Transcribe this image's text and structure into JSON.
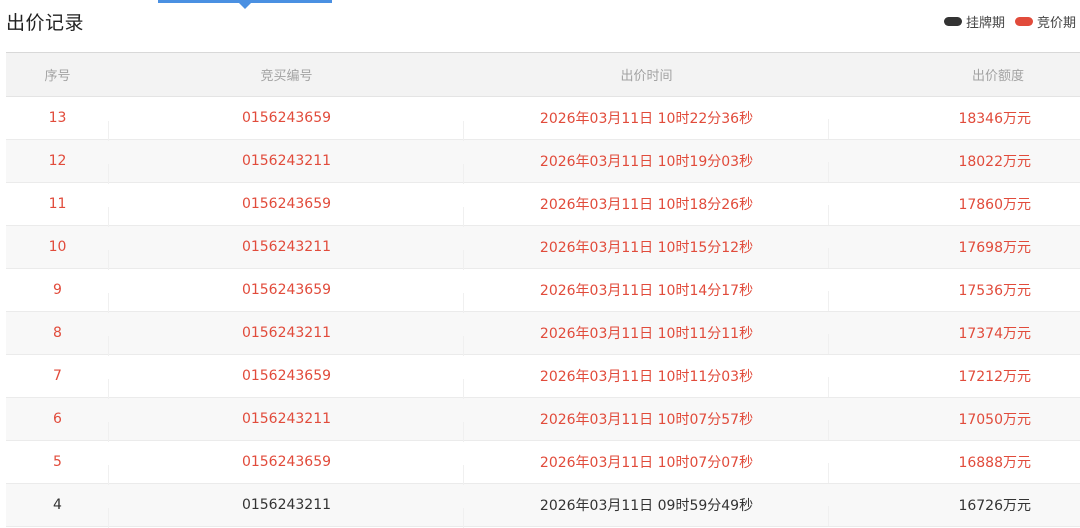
{
  "header": {
    "title": "出价记录",
    "legend": [
      {
        "label": "挂牌期",
        "color": "#333333"
      },
      {
        "label": "竞价期",
        "color": "#e14b3b"
      }
    ]
  },
  "table": {
    "columns": [
      "序号",
      "竞买编号",
      "出价时间",
      "出价额度"
    ],
    "rows": [
      {
        "no": "13",
        "bidder": "0156243659",
        "time": "2026年03月11日 10时22分36秒",
        "amount": "18346万元",
        "phase": "bid"
      },
      {
        "no": "12",
        "bidder": "0156243211",
        "time": "2026年03月11日 10时19分03秒",
        "amount": "18022万元",
        "phase": "bid"
      },
      {
        "no": "11",
        "bidder": "0156243659",
        "time": "2026年03月11日 10时18分26秒",
        "amount": "17860万元",
        "phase": "bid"
      },
      {
        "no": "10",
        "bidder": "0156243211",
        "time": "2026年03月11日 10时15分12秒",
        "amount": "17698万元",
        "phase": "bid"
      },
      {
        "no": "9",
        "bidder": "0156243659",
        "time": "2026年03月11日 10时14分17秒",
        "amount": "17536万元",
        "phase": "bid"
      },
      {
        "no": "8",
        "bidder": "0156243211",
        "time": "2026年03月11日 10时11分11秒",
        "amount": "17374万元",
        "phase": "bid"
      },
      {
        "no": "7",
        "bidder": "0156243659",
        "time": "2026年03月11日 10时11分03秒",
        "amount": "17212万元",
        "phase": "bid"
      },
      {
        "no": "6",
        "bidder": "0156243211",
        "time": "2026年03月11日 10时07分57秒",
        "amount": "17050万元",
        "phase": "bid"
      },
      {
        "no": "5",
        "bidder": "0156243659",
        "time": "2026年03月11日 10时07分07秒",
        "amount": "16888万元",
        "phase": "bid"
      },
      {
        "no": "4",
        "bidder": "0156243211",
        "time": "2026年03月11日 09时59分49秒",
        "amount": "16726万元",
        "phase": "list"
      }
    ]
  }
}
